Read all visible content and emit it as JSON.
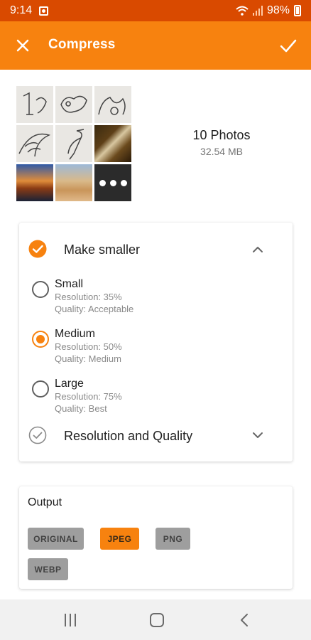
{
  "status_bar": {
    "time": "9:14",
    "battery": "98%"
  },
  "app_bar": {
    "title": "Compress"
  },
  "summary": {
    "count": "10 Photos",
    "size": "32.54 MB"
  },
  "make_smaller": {
    "title": "Make smaller",
    "options": [
      {
        "name": "Small",
        "resolution": "Resolution: 35%",
        "quality": "Quality: Acceptable",
        "selected": false
      },
      {
        "name": "Medium",
        "resolution": "Resolution: 50%",
        "quality": "Quality: Medium",
        "selected": true
      },
      {
        "name": "Large",
        "resolution": "Resolution: 75%",
        "quality": "Quality: Best",
        "selected": false
      }
    ]
  },
  "resolution_quality": {
    "title": "Resolution and Quality"
  },
  "output": {
    "label": "Output",
    "formats": [
      "ORIGINAL",
      "JPEG",
      "PNG",
      "WEBP"
    ],
    "selected": "JPEG"
  },
  "colors": {
    "accent": "#f7820f",
    "status_bar": "#d94a00"
  }
}
